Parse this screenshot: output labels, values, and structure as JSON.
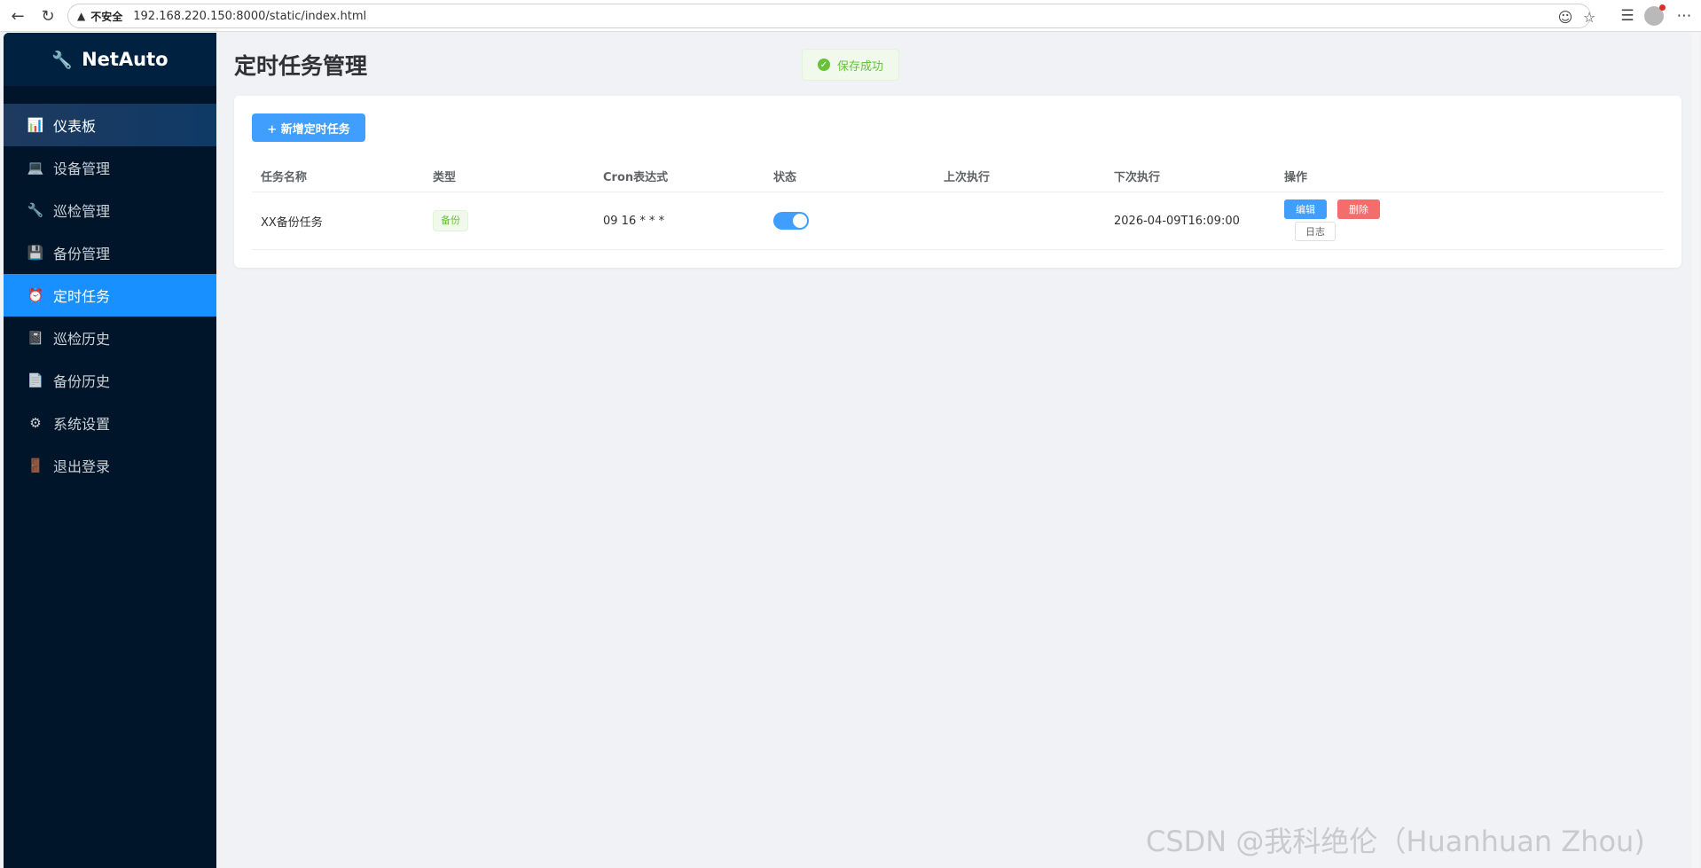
{
  "browser": {
    "security_label": "不安全",
    "url": "192.168.220.150:8000/static/index.html",
    "icons": [
      "back-icon",
      "reload-icon",
      "warning-icon",
      "reader-icon",
      "star-icon",
      "favorites-icon",
      "profile-avatar",
      "more-icon"
    ]
  },
  "sidebar": {
    "logo_text": "NetAuto",
    "items": [
      {
        "label": "仪表板",
        "icon": "dashboard-icon"
      },
      {
        "label": "设备管理",
        "icon": "laptop-icon"
      },
      {
        "label": "巡检管理",
        "icon": "wrench-icon"
      },
      {
        "label": "备份管理",
        "icon": "floppy-icon"
      },
      {
        "label": "定时任务",
        "icon": "alarm-clock-icon",
        "active": true
      },
      {
        "label": "巡检历史",
        "icon": "notebook-icon"
      },
      {
        "label": "备份历史",
        "icon": "page-icon"
      },
      {
        "label": "系统设置",
        "icon": "gear-icon"
      },
      {
        "label": "退出登录",
        "icon": "door-icon"
      }
    ]
  },
  "main": {
    "title": "定时任务管理",
    "toast": "保存成功",
    "add_button": "+ 新增定时任务",
    "table": {
      "headers": [
        "任务名称",
        "类型",
        "Cron表达式",
        "状态",
        "上次执行",
        "下次执行",
        "操作"
      ],
      "rows": [
        {
          "name": "XX备份任务",
          "type": "备份",
          "cron": "09 16 * * *",
          "enabled": true,
          "last_run": "",
          "next_run": "2026-04-09T16:09:00",
          "actions": {
            "edit": "编辑",
            "delete": "删除",
            "log": "日志"
          }
        }
      ]
    }
  },
  "watermark": "CSDN @我科绝伦（Huanhuan Zhou)",
  "colors": {
    "sidebar_bg": "#001529",
    "active_item": "#1890ff",
    "primary": "#409eff",
    "danger": "#f56c6c",
    "success": "#67c23a"
  }
}
